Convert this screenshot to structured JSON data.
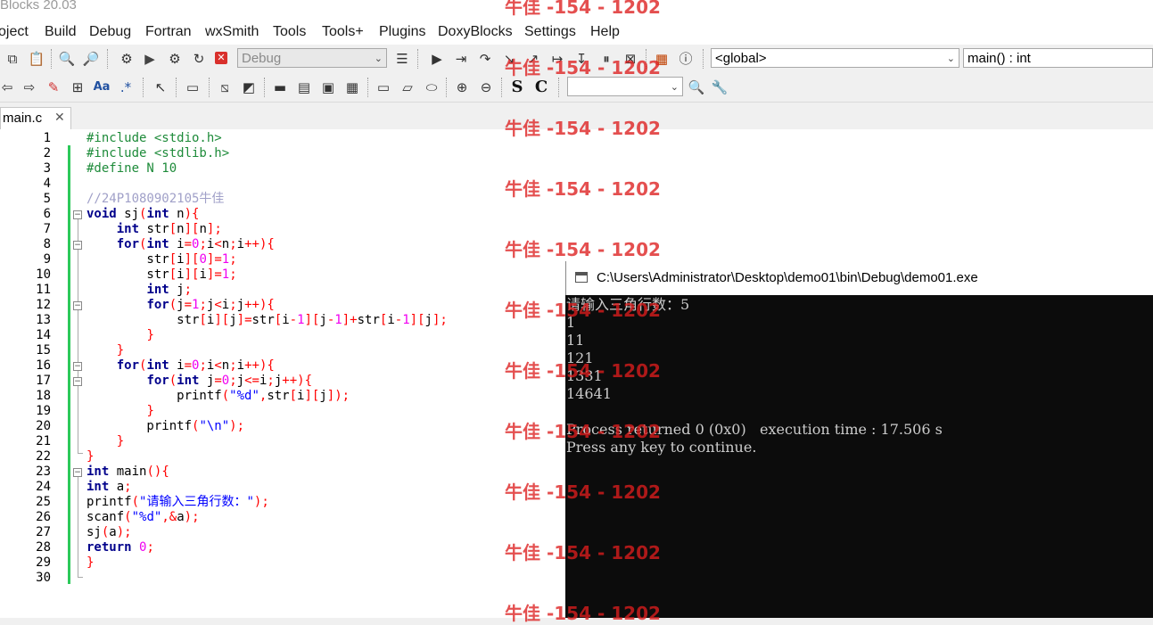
{
  "app": {
    "title": "Blocks 20.03"
  },
  "menu": [
    "oject",
    "Build",
    "Debug",
    "Fortran",
    "wxSmith",
    "Tools",
    "Tools+",
    "Plugins",
    "DoxyBlocks",
    "Settings",
    "Help"
  ],
  "toolbar": {
    "build_target": "Debug",
    "scope": "<global>",
    "symbol": "main() : int",
    "search_value": ""
  },
  "tab": {
    "label": "main.c",
    "close": "✕"
  },
  "editor": {
    "line_numbers": [
      "1",
      "2",
      "3",
      "4",
      "5",
      "6",
      "7",
      "8",
      "9",
      "10",
      "11",
      "12",
      "13",
      "14",
      "15",
      "16",
      "17",
      "18",
      "19",
      "20",
      "21",
      "22",
      "23",
      "24",
      "25",
      "26",
      "27",
      "28",
      "29",
      "30"
    ],
    "lines": [
      "#include <stdio.h>",
      "#include <stdlib.h>",
      "#define N 10",
      "",
      "//24P1080902105牛佳",
      "void sj(int n){",
      "    int str[n][n];",
      "    for(int i=0;i<n;i++){",
      "        str[i][0]=1;",
      "        str[i][i]=1;",
      "        int j;",
      "        for(j=1;j<i;j++){",
      "            str[i][j]=str[i-1][j-1]+str[i-1][j];",
      "        }",
      "    }",
      "    for(int i=0;i<n;i++){",
      "        for(int j=0;j<=i;j++){",
      "            printf(\"%d\",str[i][j]);",
      "        }",
      "        printf(\"\\n\");",
      "    }",
      "}",
      "int main(){",
      "int a;",
      "printf(\"请输入三角行数：\");",
      "scanf(\"%d\",&a);",
      "sj(a);",
      "return 0;",
      "}",
      ""
    ]
  },
  "console": {
    "title": "C:\\Users\\Administrator\\Desktop\\demo01\\bin\\Debug\\demo01.exe",
    "lines": [
      "请输入三角行数：5",
      "1",
      "11",
      "121",
      "1331",
      "14641",
      "",
      "Process returned 0 (0x0)   execution time : 17.506 s",
      "Press any key to continue."
    ]
  },
  "watermark": {
    "text": "牛佳 -154 - 1202"
  },
  "colors": {
    "keyword": "#00008b",
    "preprocessor": "#1e8b3a",
    "comment": "#a0a0c8",
    "string": "#0000ff",
    "number": "#f000f0",
    "operator": "#ff0000",
    "change_bar": "#2cc95a",
    "watermark": "#dc1e1e"
  }
}
